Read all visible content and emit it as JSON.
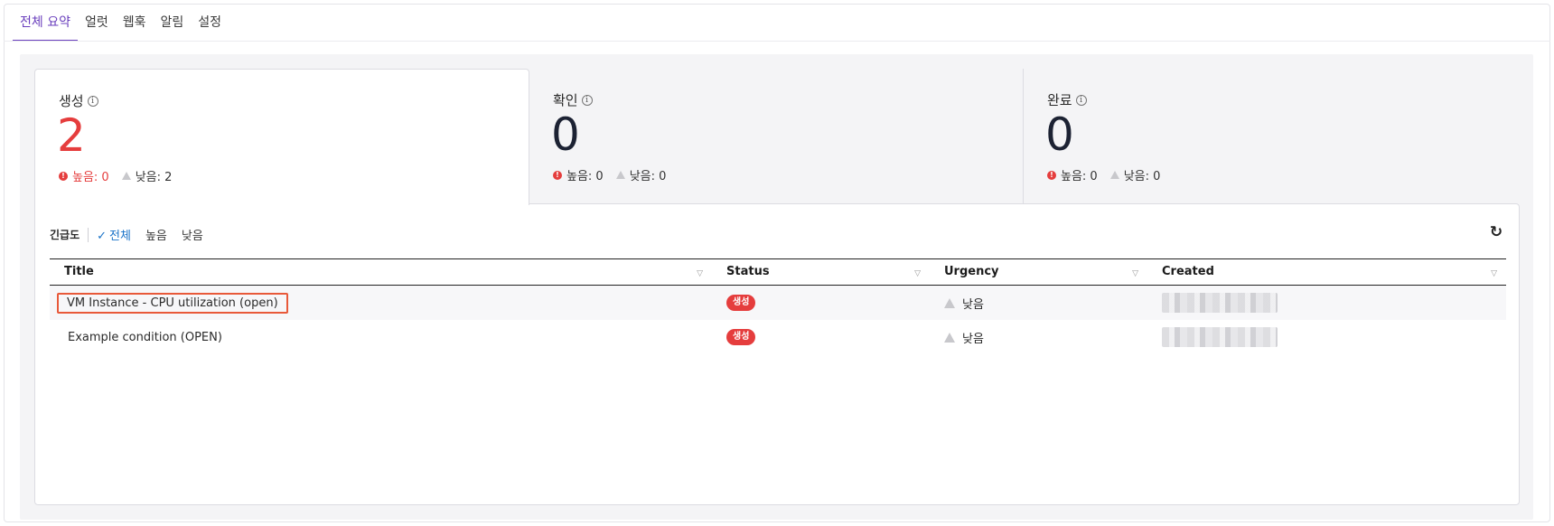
{
  "tabs": [
    {
      "label": "전체 요약",
      "active": true
    },
    {
      "label": "얼럿",
      "active": false
    },
    {
      "label": "웹훅",
      "active": false
    },
    {
      "label": "알림",
      "active": false
    },
    {
      "label": "설정",
      "active": false
    }
  ],
  "summary": [
    {
      "title": "생성",
      "count": "2",
      "high_label": "높음: 0",
      "low_label": "낮음: 2"
    },
    {
      "title": "확인",
      "count": "0",
      "high_label": "높음: 0",
      "low_label": "낮음: 0"
    },
    {
      "title": "완료",
      "count": "0",
      "high_label": "높음: 0",
      "low_label": "낮음: 0"
    }
  ],
  "filter": {
    "label": "긴급도",
    "options": [
      "전체",
      "높음",
      "낮음"
    ],
    "selected": "전체"
  },
  "table": {
    "columns": [
      "Title",
      "Status",
      "Urgency",
      "Created"
    ],
    "rows": [
      {
        "title": "VM Instance - CPU utilization (open)",
        "status": "생성",
        "urgency": "낮음",
        "created": ""
      },
      {
        "title": "Example condition (OPEN)",
        "status": "생성",
        "urgency": "낮음",
        "created": ""
      }
    ]
  },
  "colors": {
    "accent": "#6a3fbd",
    "alert_red": "#e53d3d",
    "filter_blue": "#1a73c8",
    "highlight_box": "#e8593a"
  },
  "icons": {
    "info": "info-icon",
    "high": "exclamation-circle-icon",
    "low": "warning-triangle-icon",
    "check": "check-icon",
    "refresh": "refresh-icon",
    "sort": "sort-icon"
  }
}
